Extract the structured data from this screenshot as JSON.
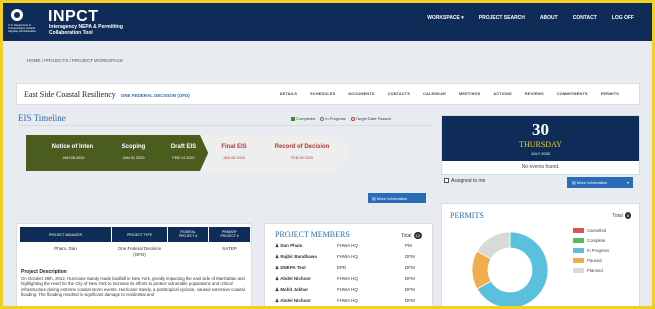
{
  "brand": {
    "agency": "U.S. Department of Transportation Federal Highway Administration",
    "name": "INPCT",
    "subtitle": "Interagency NEPA & Permitting Collaboration Tool"
  },
  "nav": [
    "WORKSPACE ▾",
    "PROJECT SEARCH",
    "ABOUT",
    "CONTACT",
    "LOG OFF"
  ],
  "breadcrumb": "HOME  /  PROJECTS  /  PROJECT WORKSPACE",
  "project": {
    "title": "East Side Coastal Resiliency",
    "ofd_label": "ONE FEDERAL DECISION (OFD)"
  },
  "tabs": [
    "DETAILS",
    "SCHEDULES",
    "DOCUMENTS",
    "CONTACTS",
    "CALENDAR",
    "MEETINGS",
    "ACTIONS",
    "REVIEWS",
    "COMMITMENTS",
    "PERMITS"
  ],
  "eis": {
    "title": "EIS Timeline",
    "legend": [
      {
        "label": "Completed",
        "color": "#3d8b2e",
        "shape": "square"
      },
      {
        "label": "In Progress",
        "color": "#777777",
        "shape": "circle"
      },
      {
        "label": "Target Date Passed",
        "color": "#c0392b",
        "shape": "circle"
      }
    ],
    "steps": [
      {
        "label": "Notice of Intent",
        "date": "JAN 08 2020",
        "status": "completed"
      },
      {
        "label": "Scoping",
        "date": "JAN 31 2020",
        "status": "completed"
      },
      {
        "label": "Draft EIS",
        "date": "FEB 14 2020",
        "status": "completed"
      },
      {
        "label": "Final EIS",
        "date": "JAN 08 2020",
        "status": "pending"
      },
      {
        "label": "Record of Decision",
        "date": "FEB 06 2020",
        "status": "pending"
      }
    ],
    "more_label": "More Information"
  },
  "calendar": {
    "day": "30",
    "weekday": "THURSDAY",
    "month": "JULY 2020",
    "no_events": "No events found."
  },
  "assigned_label": "Assigned to me",
  "more_info_dropdown": "More Information",
  "project_table": {
    "headers": [
      "PROJECT MANAGER",
      "PROJECT TYPE",
      "FEDERAL PROJECT #",
      "PRIMARY PROJECT #"
    ],
    "row": [
      "Pham, Dan",
      "One Federal Decision (OFD)",
      "",
      "SATEP"
    ]
  },
  "description": {
    "heading": "Project Description",
    "text": "On October 29th, 2012, Hurricane Sandy made landfall in New York, greatly impacting the east side of Manhattan and highlighting the need for the City of New York to increase its efforts to protect vulnerable populations and critical infrastructure during extreme coastal storm events. Hurricane Sandy, a posttropical cyclone, caused extensive coastal flooding. The flooding resulted in significant damage to residential and"
  },
  "members": {
    "title": "PROJECT MEMBERS",
    "total_label": "Total",
    "total": "12",
    "rows": [
      {
        "name": "Dan Pham",
        "org": "FHWA HQ",
        "role": "PM"
      },
      {
        "name": "Rajbir Bandhawa",
        "org": "FHWA HQ",
        "role": "DFM"
      },
      {
        "name": "DNEPA Test",
        "org": "EPD",
        "role": "DFM"
      },
      {
        "name": "Abdel Nichoor",
        "org": "FHWA HQ",
        "role": "DFM"
      },
      {
        "name": "Mohit Jakhar",
        "org": "FHWA HQ",
        "role": "DFM"
      },
      {
        "name": "Abdel Nichoor",
        "org": "FHWA HQ",
        "role": "DFM"
      }
    ]
  },
  "permits": {
    "title": "PERMITS",
    "total_label": "Total",
    "total": "6",
    "legend": [
      {
        "label": "Cancelled",
        "color": "#d9534f"
      },
      {
        "label": "Complete",
        "color": "#5cb85c"
      },
      {
        "label": "In Progress",
        "color": "#5bc0de"
      },
      {
        "label": "Paused",
        "color": "#f0ad4e"
      },
      {
        "label": "Planned",
        "color": "#d9d9d9"
      }
    ],
    "chart_data": {
      "type": "pie",
      "categories": [
        "Cancelled",
        "Complete",
        "In Progress",
        "Paused",
        "Planned"
      ],
      "values": [
        0,
        0,
        4,
        1,
        1
      ]
    }
  }
}
